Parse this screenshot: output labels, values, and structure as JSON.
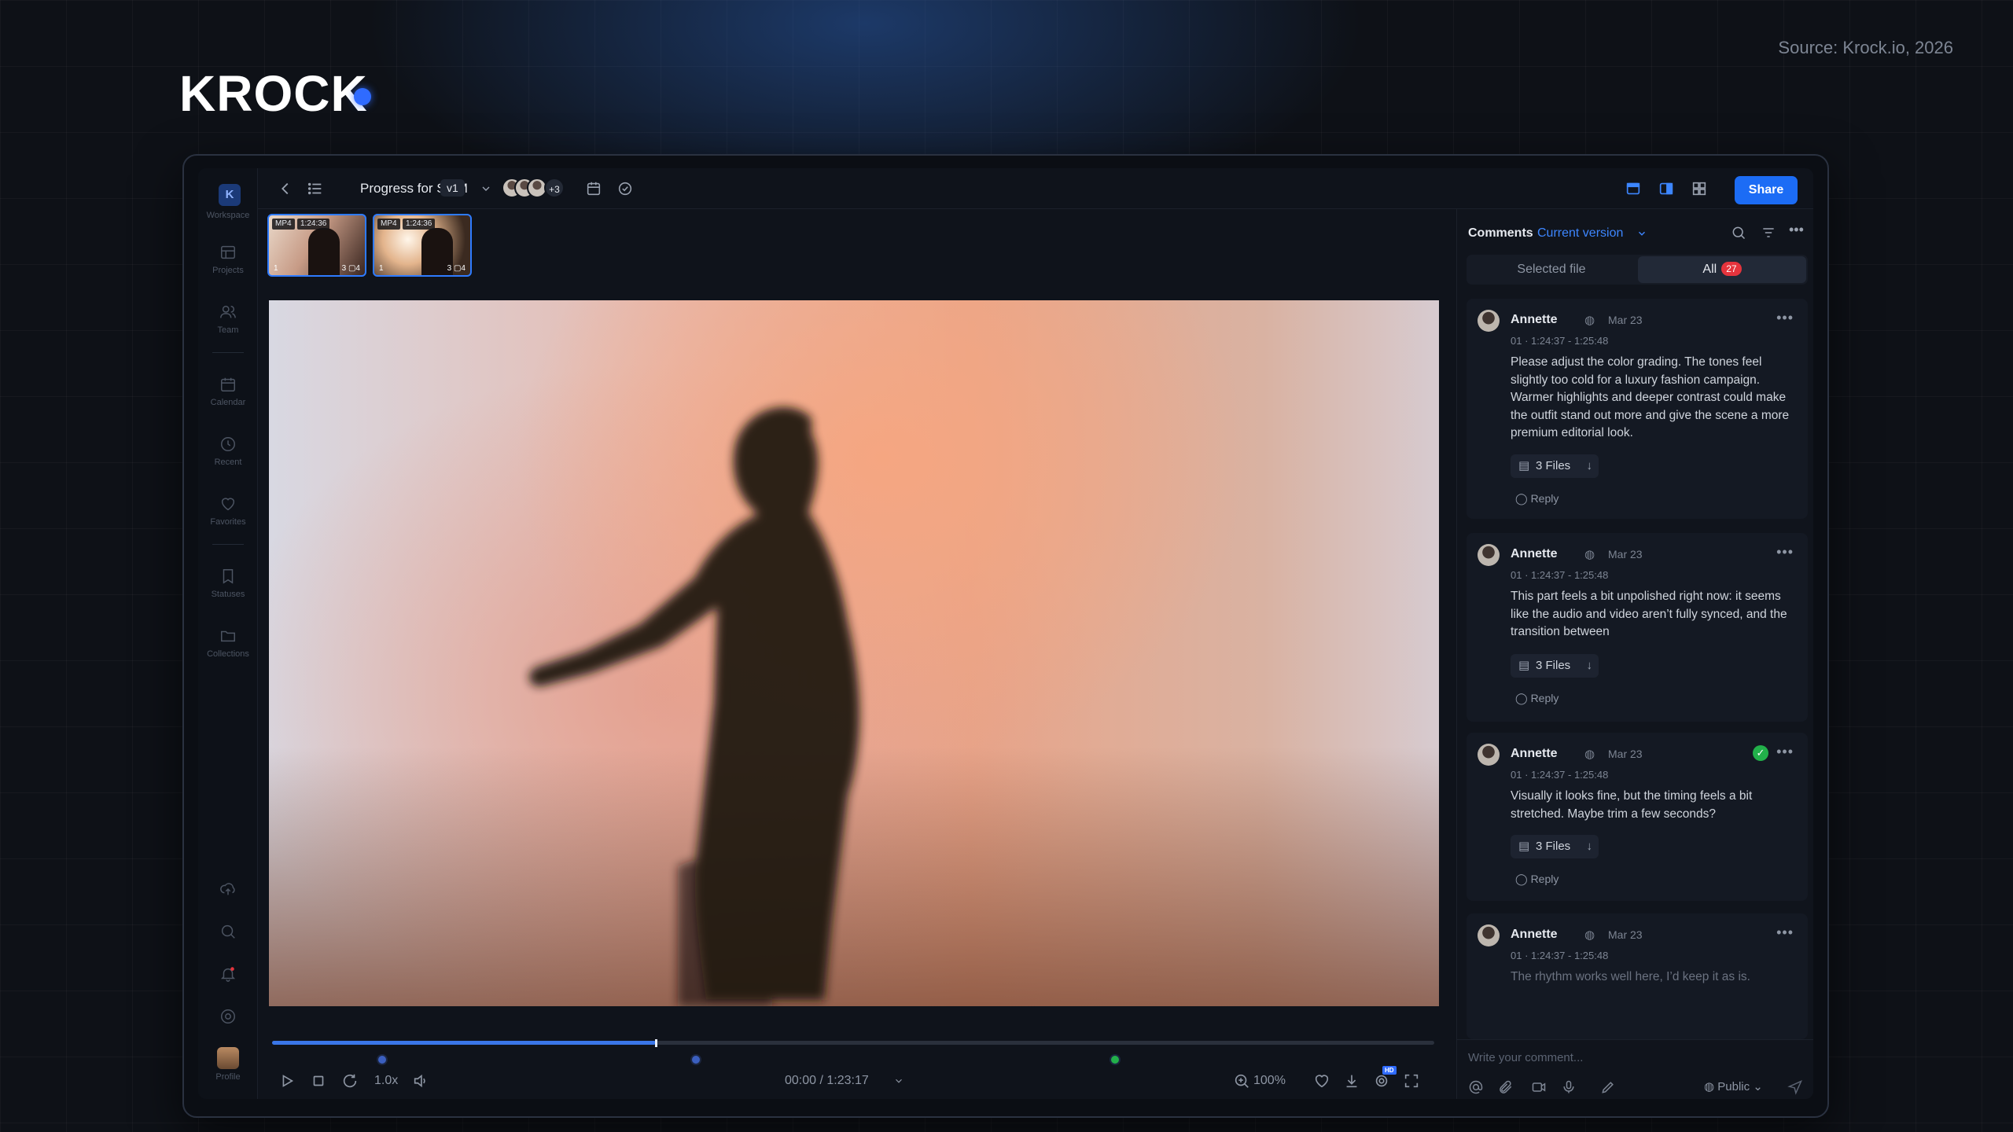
{
  "brand": {
    "logo": "KROCK",
    "source": "Source: Krock.io, 2026"
  },
  "sidebar": {
    "workspace_badge": "K",
    "items": [
      {
        "label": "Workspace",
        "icon": "workspace-icon"
      },
      {
        "label": "Projects",
        "icon": "projects-icon"
      },
      {
        "label": "Team",
        "icon": "team-icon"
      },
      {
        "label": "Calendar",
        "icon": "calendar-icon"
      },
      {
        "label": "Recent",
        "icon": "recent-icon"
      },
      {
        "label": "Favorites",
        "icon": "heart-icon"
      },
      {
        "label": "Statuses",
        "icon": "bookmark-icon"
      },
      {
        "label": "Collections",
        "icon": "folder-icon"
      }
    ],
    "bottom": [
      {
        "label": "",
        "icon": "upload-icon"
      },
      {
        "label": "",
        "icon": "search-icon"
      },
      {
        "label": "",
        "icon": "bell-icon"
      },
      {
        "label": "",
        "icon": "settings-icon"
      },
      {
        "label": "Profile",
        "icon": "avatar"
      }
    ]
  },
  "topbar": {
    "title": "Progress for SMM",
    "version": "v1",
    "avatars_more": "+3",
    "share_label": "Share"
  },
  "thumbnails": [
    {
      "format": "MP4",
      "duration": "1:24:36",
      "index": "1",
      "stats": "3 ▢4"
    },
    {
      "format": "MP4",
      "duration": "1:24:36",
      "index": "1",
      "stats": "3 ▢4"
    }
  ],
  "player": {
    "progress": 0.33,
    "markers": [
      0.095,
      0.365,
      0.725
    ],
    "markers_status": [
      "pending",
      "pending",
      "resolved"
    ],
    "speed": "1.0x",
    "time": "00:00 / 1:23:17",
    "zoom": "100%",
    "hd_badge": "HD"
  },
  "comments": {
    "header": "Comments",
    "version_filter": "Current version",
    "tabs": {
      "selected": "Selected file",
      "all": "All",
      "all_count": "27"
    },
    "items": [
      {
        "author": "Annette",
        "date": "Mar 23",
        "range": "01 · 1:24:37 - 1:25:48",
        "text": "Please adjust the color grading. The tones feel slightly too cold for a luxury fashion campaign. Warmer highlights and deeper contrast could make the outfit stand out more and give the scene a more premium editorial look.",
        "files": "3 Files",
        "reply": "Reply",
        "resolved": false
      },
      {
        "author": "Annette",
        "date": "Mar 23",
        "range": "01 · 1:24:37 - 1:25:48",
        "text": "This part feels a bit unpolished right now: it seems like the audio and video aren’t fully synced, and the transition between",
        "files": "3 Files",
        "reply": "Reply",
        "resolved": false
      },
      {
        "author": "Annette",
        "date": "Mar 23",
        "range": "01 · 1:24:37 - 1:25:48",
        "text": "Visually it looks fine, but the timing feels a bit stretched. Maybe trim a few seconds?",
        "files": "3 Files",
        "reply": "Reply",
        "resolved": true
      },
      {
        "author": "Annette",
        "date": "Mar 23",
        "range": "01 · 1:24:37 - 1:25:48",
        "text": "The rhythm works well here, I’d keep it as is.",
        "files": "",
        "reply": "",
        "resolved": false
      }
    ],
    "composer_placeholder": "Write your comment...",
    "visibility": "Public"
  },
  "colors": {
    "accent": "#1c6cf5",
    "resolved": "#22b04a",
    "badge": "#e5343d"
  }
}
